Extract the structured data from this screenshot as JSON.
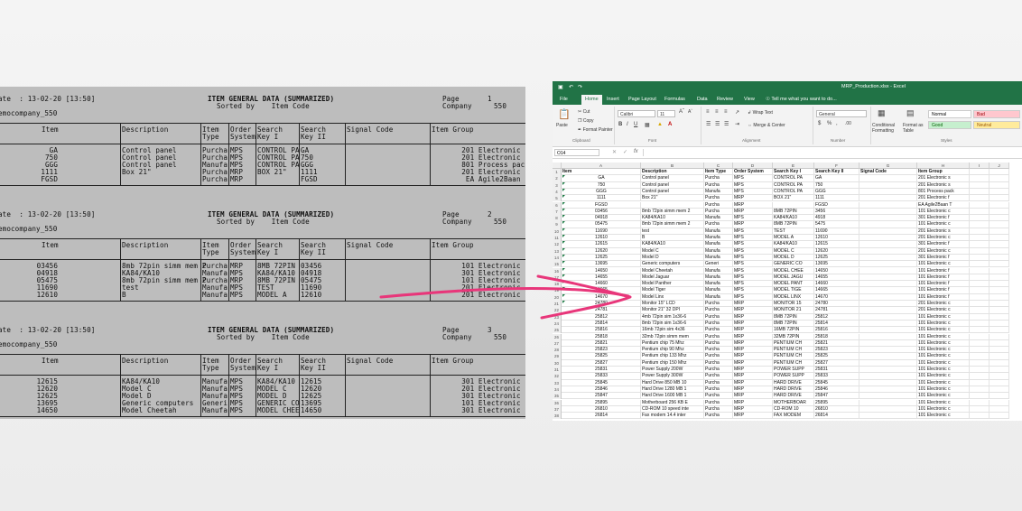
{
  "report": {
    "pages": [
      {
        "date_line": "ate  : 13-02-20 [13:50]",
        "title": "ITEM GENERAL DATA (SUMMARIZED)",
        "sorted_line": "Sorted by    Item Code",
        "page_label": "Page",
        "page_num": "1",
        "company_label": "Company",
        "company_num": "550",
        "company_name": "emocompany_550",
        "headers": [
          "Item",
          "Description",
          "Item\nType",
          "Order\nSystem",
          "Search\nKey I",
          "Search\nKey II",
          "Signal Code",
          "Item Group"
        ],
        "rows": [
          [
            "GA",
            "Control panel",
            "Purcha",
            "MPS",
            "CONTROL PA",
            "GA",
            "",
            "201 Electronic s"
          ],
          [
            "750",
            "Control panel",
            "Purcha",
            "MPS",
            "CONTROL PA",
            "750",
            "",
            "201 Electronic s"
          ],
          [
            "GGG",
            "Control panel",
            "Manufa",
            "MPS",
            "CONTROL PA",
            "GGG",
            "",
            "801 Process pack"
          ],
          [
            "1111",
            "Box 21\"",
            "Purcha",
            "MRP",
            "BOX 21\"",
            "1111",
            "",
            "201 Electronic F"
          ],
          [
            "FGSD",
            "",
            "Purcha",
            "MRP",
            "",
            "FGSD",
            "",
            "EA Agile2Baan F"
          ]
        ]
      },
      {
        "date_line": "ate  : 13-02-20 [13:50]",
        "title": "ITEM GENERAL DATA (SUMMARIZED)",
        "sorted_line": "Sorted by    Item Code",
        "page_label": "Page",
        "page_num": "2",
        "company_label": "Company",
        "company_num": "550",
        "company_name": "emocompany_550",
        "headers": [
          "Item",
          "Description",
          "Item\nType",
          "Order\nSystem",
          "Search\nKey I",
          "Search\nKey II",
          "Signal Code",
          "Item Group"
        ],
        "rows": [
          [
            "03456",
            "8mb 72pin simm mem 2",
            "Purcha",
            "MRP",
            "8MB 72PIN",
            "03456",
            "",
            "101 Electronic c"
          ],
          [
            "04918",
            "KA84/KA10",
            "Manufa",
            "MPS",
            "KA84/KA10",
            "04918",
            "",
            "301 Electronic F"
          ],
          [
            "05475",
            "8mb 72pin simm mem 2",
            "Purcha",
            "MRP",
            "8MB 72PIN",
            "05475",
            "",
            "101 Electronic c"
          ],
          [
            "11690",
            "test",
            "Manufa",
            "MPS",
            "TEST",
            "11690",
            "",
            "201 Electronic s"
          ],
          [
            "12610",
            "B",
            "Manufa",
            "MPS",
            "MODEL A",
            "12610",
            "",
            "201 Electronic c"
          ]
        ]
      },
      {
        "date_line": "ate  : 13-02-20 [13:50]",
        "title": "ITEM GENERAL DATA (SUMMARIZED)",
        "sorted_line": "Sorted by    Item Code",
        "page_label": "Page",
        "page_num": "3",
        "company_label": "Company",
        "company_num": "550",
        "company_name": "emocompany_550",
        "headers": [
          "Item",
          "Description",
          "Item\nType",
          "Order\nSystem",
          "Search\nKey I",
          "Search\nKey II",
          "Signal Code",
          "Item Group"
        ],
        "rows": [
          [
            "12615",
            "KA84/KA10",
            "Manufa",
            "MPS",
            "KA84/KA10",
            "12615",
            "",
            "301 Electronic F"
          ],
          [
            "12620",
            "Model C",
            "Manufa",
            "MPS",
            "MODEL C",
            "12620",
            "",
            "201 Electronic c"
          ],
          [
            "12625",
            "Model D",
            "Manufa",
            "MPS",
            "MODEL D",
            "12625",
            "",
            "301 Electronic f"
          ],
          [
            "13695",
            "Generic computers",
            "Generi",
            "MPS",
            "GENERIC CO",
            "13695",
            "",
            "101 Electronic c"
          ],
          [
            "14650",
            "Model Cheetah",
            "Manufa",
            "MPS",
            "MODEL CHEE",
            "14650",
            "",
            "301 Electronic f"
          ]
        ]
      }
    ]
  },
  "excel": {
    "title": "MRP_Production.xlsx - Excel",
    "tabs": [
      "File",
      "Home",
      "Insert",
      "Page Layout",
      "Formulas",
      "Data",
      "Review",
      "View"
    ],
    "tell_me": "Tell me what you want to do...",
    "clipboard": {
      "paste": "Paste",
      "cut": "Cut",
      "copy": "Copy",
      "format_painter": "Format Painter",
      "label": "Clipboard"
    },
    "font": {
      "name": "Calibri",
      "size": "11",
      "label": "Font"
    },
    "alignment": {
      "wrap": "Wrap Text",
      "merge": "Merge & Center",
      "label": "Alignment"
    },
    "number": {
      "format": "General",
      "label": "Number"
    },
    "styles": {
      "conditional": "Conditional Formatting",
      "format_as_table": "Format as Table",
      "normal": "Normal",
      "bad": "Bad",
      "good": "Good",
      "neutral": "Neutral",
      "label": "Styles"
    },
    "name_box": "O14",
    "columns": [
      "A",
      "B",
      "C",
      "D",
      "E",
      "F",
      "G",
      "H",
      "I",
      "J"
    ],
    "rows": [
      [
        "1",
        "Item",
        "Description",
        "Item Type",
        "Order System",
        "Search Key I",
        "Search Key II",
        "Signal Code",
        "Item Group"
      ],
      [
        "2",
        "GA",
        "Control panel",
        "Purcha",
        "MPS",
        "CONTROL PA",
        "GA",
        "",
        "201 Electronic s"
      ],
      [
        "3",
        "750",
        "Control panel",
        "Purcha",
        "MPS",
        "CONTROL PA",
        "750",
        "",
        "201 Electronic s"
      ],
      [
        "4",
        "GGG",
        "Control panel",
        "Manufa",
        "MPS",
        "CONTROL PA",
        "GGG",
        "",
        "801 Process pack"
      ],
      [
        "5",
        "1111",
        "Box 21\"",
        "Purcha",
        "MRP",
        "BOX 21\"",
        "1111",
        "",
        "201 Electronic f"
      ],
      [
        "6",
        "FGSD",
        "",
        "Purcha",
        "MRP",
        "",
        "FGSD",
        "",
        "EA Agile2Baan T"
      ],
      [
        "7",
        "03456",
        "8mb 72pin simm mem 2",
        "Purcha",
        "MRP",
        "8MB 72PIN",
        "3456",
        "",
        "101 Electronic c"
      ],
      [
        "8",
        "04918",
        "KA84/KA10",
        "Manufa",
        "MPS",
        "KA84/KA10",
        "4918",
        "",
        "301 Electronic f"
      ],
      [
        "9",
        "05475",
        "8mb 72pin simm mem 2",
        "Purcha",
        "MRP",
        "8MB 72PIN",
        "5475",
        "",
        "101 Electronic c"
      ],
      [
        "10",
        "11690",
        "test",
        "Manufa",
        "MPS",
        "TEST",
        "11690",
        "",
        "201 Electronic s"
      ],
      [
        "11",
        "12610",
        "B",
        "Manufa",
        "MPS",
        "MODEL A",
        "12610",
        "",
        "201 Electronic c"
      ],
      [
        "12",
        "12615",
        "KA84/KA10",
        "Manufa",
        "MPS",
        "KA84/KA10",
        "12615",
        "",
        "301 Electronic f"
      ],
      [
        "13",
        "12620",
        "Model C",
        "Manufa",
        "MPS",
        "MODEL C",
        "12620",
        "",
        "201 Electronic c"
      ],
      [
        "14",
        "12625",
        "Model D",
        "Manufa",
        "MPS",
        "MODEL D",
        "12625",
        "",
        "301 Electronic f"
      ],
      [
        "15",
        "13695",
        "Generic computers",
        "Generi",
        "MPS",
        "GENERIC CO",
        "13695",
        "",
        "101 Electronic c"
      ],
      [
        "16",
        "14650",
        "Model Cheetah",
        "Manufa",
        "MPS",
        "MODEL CHEE",
        "14650",
        "",
        "101 Electronic f"
      ],
      [
        "17",
        "14655",
        "Model Jaguar",
        "Manufa",
        "MPS",
        "MODEL JAGU",
        "14655",
        "",
        "101 Electronic f"
      ],
      [
        "18",
        "14660",
        "Model Panther",
        "Manufa",
        "MPS",
        "MODEL PANT",
        "14660",
        "",
        "101 Electronic f"
      ],
      [
        "19",
        "14665",
        "Model Tiger",
        "Manufa",
        "MPS",
        "MODEL TIGE",
        "14665",
        "",
        "101 Electronic f"
      ],
      [
        "20",
        "14670",
        "Model Linx",
        "Manufa",
        "MPS",
        "MODEL LINX",
        "14670",
        "",
        "101 Electronic f"
      ],
      [
        "21",
        "24780",
        "Monitor 15\" LCD",
        "Purcha",
        "MRP",
        "MONITOR 15",
        "24780",
        "",
        "201 Electronic c"
      ],
      [
        "22",
        "24781",
        "Monitor 21\" 32 DPI",
        "Purcha",
        "MRP",
        "MONITOR 21",
        "24781",
        "",
        "201 Electronic c"
      ],
      [
        "23",
        "25812",
        "4mb 72pin sim 1x36-6",
        "Purcha",
        "MRP",
        "8MB 72PIN",
        "25812",
        "",
        "101 Electronic c"
      ],
      [
        "24",
        "25814",
        "8mb 72pin sim 1x36-6",
        "Purcha",
        "MRP",
        "8MB 72PIN",
        "25814",
        "",
        "101 Electronic c"
      ],
      [
        "25",
        "25816",
        "16mb 72pin sim 4x36",
        "Purcha",
        "MRP",
        "16MB 72PIN",
        "25816",
        "",
        "101 Electronic c"
      ],
      [
        "26",
        "25818",
        "32mb 72pin simm mem",
        "Purcha",
        "MRP",
        "32MB 72PIN",
        "25818",
        "",
        "101 Electronic c"
      ],
      [
        "27",
        "25821",
        "Pentium chip 75 Mhz",
        "Purcha",
        "MRP",
        "PENTIUM CH",
        "25821",
        "",
        "101 Electronic c"
      ],
      [
        "28",
        "25823",
        "Pentium chip 90 Mhz",
        "Purcha",
        "MRP",
        "PENTIUM CH",
        "25823",
        "",
        "101 Electronic c"
      ],
      [
        "29",
        "25825",
        "Pentium chip 133 Mhz",
        "Purcha",
        "MRP",
        "PENTIUM CH",
        "25825",
        "",
        "101 Electronic c"
      ],
      [
        "30",
        "25827",
        "Pentium chip 150 Mhz",
        "Purcha",
        "MRP",
        "PENTIUM CH",
        "25827",
        "",
        "101 Electronic c"
      ],
      [
        "31",
        "25831",
        "Power Supply 200W",
        "Purcha",
        "MRP",
        "POWER SUPP",
        "25831",
        "",
        "101 Electronic c"
      ],
      [
        "32",
        "25833",
        "Power Supply 300W",
        "Purcha",
        "MRP",
        "POWER SUPP",
        "25833",
        "",
        "101 Electronic c"
      ],
      [
        "33",
        "25845",
        "Hard Drive 850 MB 10",
        "Purcha",
        "MRP",
        "HARD DRIVE",
        "25845",
        "",
        "101 Electronic c"
      ],
      [
        "34",
        "25846",
        "Hard Drive 1280 MB 1",
        "Purcha",
        "MRP",
        "HARD DRIVE",
        "25846",
        "",
        "101 Electronic c"
      ],
      [
        "35",
        "25847",
        "Hard Drive 1600 MB 1",
        "Purcha",
        "MRP",
        "HARD DRIVE",
        "25847",
        "",
        "101 Electronic c"
      ],
      [
        "36",
        "25895",
        "Motherboard 256 KB E",
        "Purcha",
        "MRP",
        "MOTHERBOAR",
        "25895",
        "",
        "101 Electronic c"
      ],
      [
        "37",
        "26810",
        "CD-ROM 10 speed inte",
        "Purcha",
        "MRP",
        "CD-ROM 10",
        "26810",
        "",
        "101 Electronic c"
      ],
      [
        "38",
        "26814",
        "Fax modem 14.4 inter",
        "Purcha",
        "MRP",
        "FAX MODEM",
        "26814",
        "",
        "101 Electronic c"
      ]
    ]
  },
  "colors": {
    "excel_green": "#217346",
    "arrow": "#e8367a",
    "report_bg": "#bdbdbd",
    "style_bad": "#ffc7ce",
    "style_good": "#c6efce",
    "style_neutral": "#ffeb9c"
  }
}
